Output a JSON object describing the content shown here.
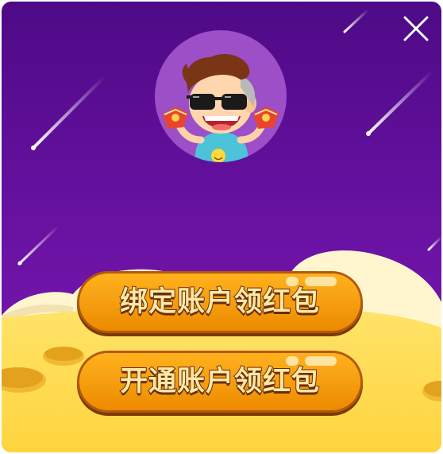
{
  "popup": {
    "buttons": [
      {
        "label": "绑定账户领红包"
      },
      {
        "label": "开通账户领红包"
      }
    ]
  },
  "icons": {
    "close": "close-icon",
    "avatar": "cartoon-man-with-sunglasses-holding-red-envelopes"
  },
  "colors": {
    "background_top": "#4e0a86",
    "background_bottom": "#7416ab",
    "avatar_circle": "#9c4fc7",
    "button": "#f7a012",
    "button_text": "#ffe8a6",
    "cloud": "#fff6d0",
    "moon": "#ffdf52"
  }
}
